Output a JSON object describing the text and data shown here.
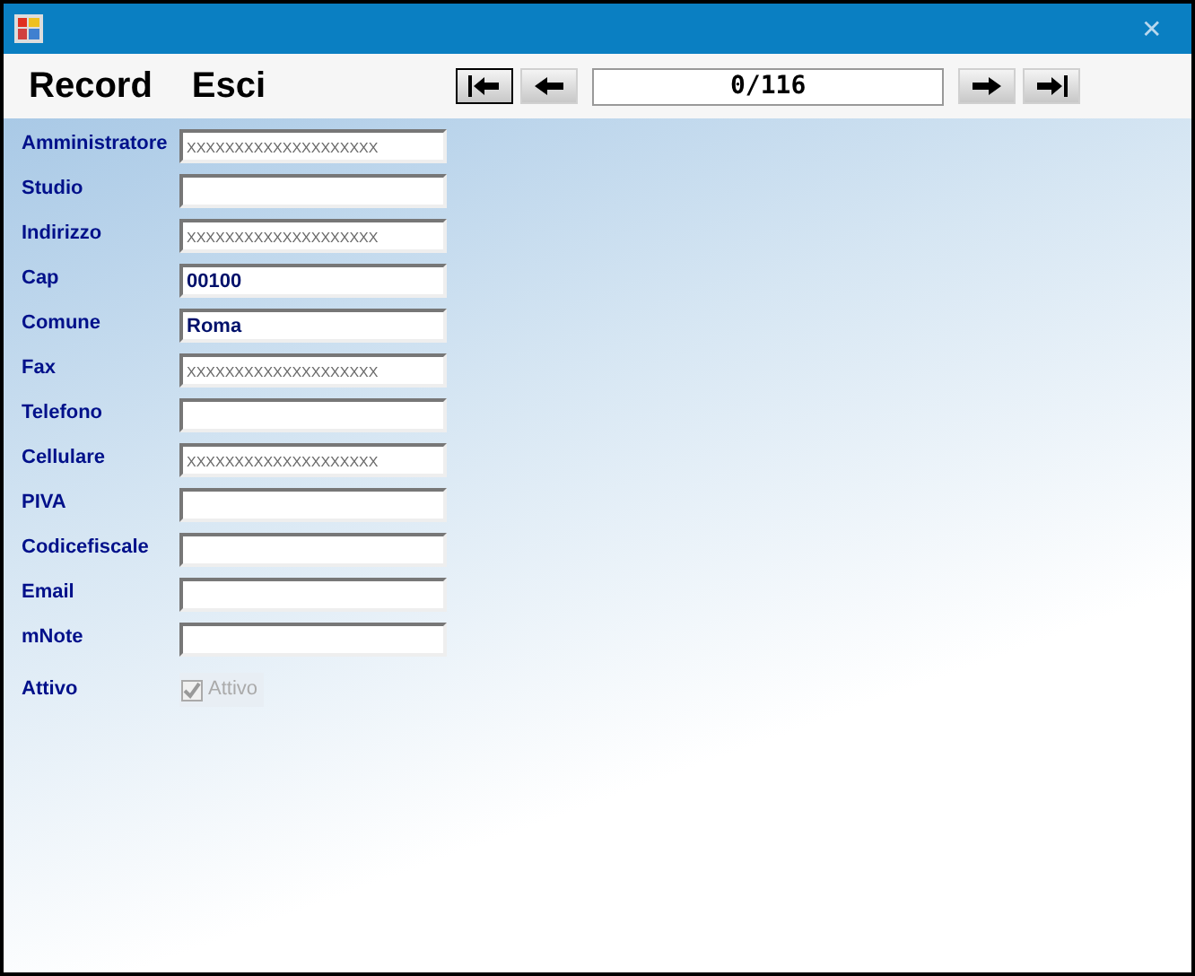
{
  "window": {
    "close": "✕"
  },
  "menu": [
    "Record",
    "Esci"
  ],
  "navigator": {
    "position": "0/116"
  },
  "fields": [
    {
      "label": "Amministratore",
      "placeholder": "XXXXXXXXXXXXXXXXXXXX"
    },
    {
      "label": "Studio"
    },
    {
      "label": "Indirizzo",
      "placeholder": "XXXXXXXXXXXXXXXXXXXX"
    },
    {
      "label": "Cap",
      "value": "00100"
    },
    {
      "label": "Comune",
      "value": "Roma"
    },
    {
      "label": "Fax",
      "placeholder": "XXXXXXXXXXXXXXXXXXXX"
    },
    {
      "label": "Telefono"
    },
    {
      "label": "Cellulare",
      "placeholder": "XXXXXXXXXXXXXXXXXXXX"
    },
    {
      "label": "PIVA"
    },
    {
      "label": "Codicefiscale"
    },
    {
      "label": "Email"
    },
    {
      "label": "mNote"
    }
  ],
  "active": {
    "label": "Attivo",
    "checkbox_label": "Attivo",
    "checked": true,
    "disabled": true
  }
}
